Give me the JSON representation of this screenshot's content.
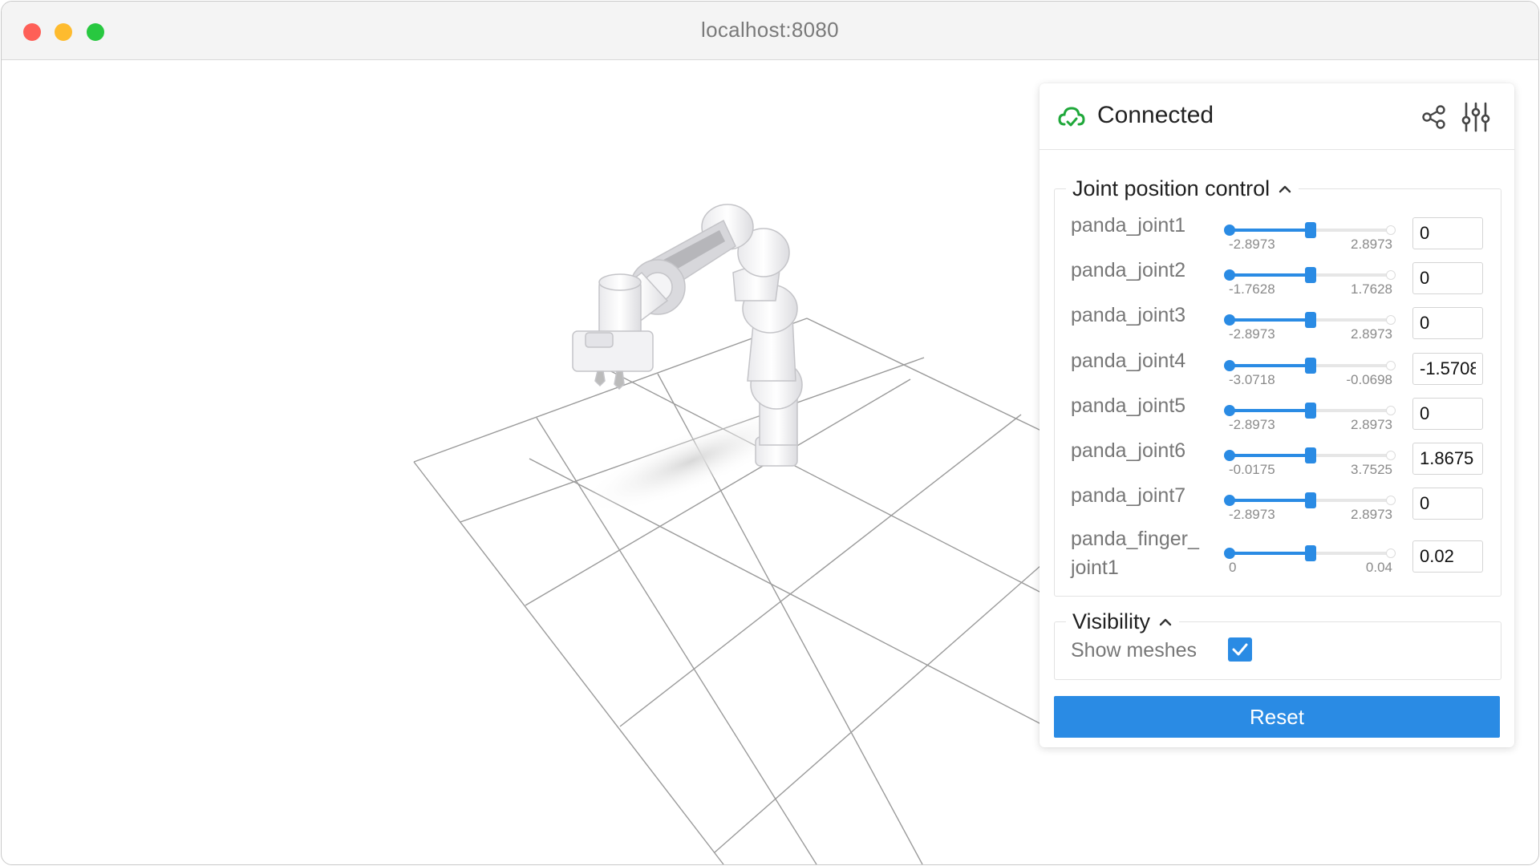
{
  "window": {
    "url": "localhost:8080"
  },
  "panel": {
    "status": "Connected",
    "status_color": "#1fa83a",
    "accent_color": "#2a8be4",
    "joint_group": {
      "title": "Joint position control",
      "joints": [
        {
          "label": "panda_joint1",
          "min": "-2.8973",
          "max": "2.8973",
          "value": "0",
          "fraction": 0.5
        },
        {
          "label": "panda_joint2",
          "min": "-1.7628",
          "max": "1.7628",
          "value": "0",
          "fraction": 0.5
        },
        {
          "label": "panda_joint3",
          "min": "-2.8973",
          "max": "2.8973",
          "value": "0",
          "fraction": 0.5
        },
        {
          "label": "panda_joint4",
          "min": "-3.0718",
          "max": "-0.0698",
          "value": "-1.5708",
          "fraction": 0.5
        },
        {
          "label": "panda_joint5",
          "min": "-2.8973",
          "max": "2.8973",
          "value": "0",
          "fraction": 0.5
        },
        {
          "label": "panda_joint6",
          "min": "-0.0175",
          "max": "3.7525",
          "value": "1.8675",
          "fraction": 0.5
        },
        {
          "label": "panda_joint7",
          "min": "-2.8973",
          "max": "2.8973",
          "value": "0",
          "fraction": 0.5
        },
        {
          "label": "panda_finger_joint1",
          "label_line1": "panda_finger_",
          "label_line2": "joint1",
          "min": "0",
          "max": "0.04",
          "value": "0.02",
          "fraction": 0.5
        }
      ]
    },
    "visibility_group": {
      "title": "Visibility",
      "show_meshes_label": "Show meshes",
      "show_meshes_checked": true
    },
    "reset_label": "Reset"
  },
  "icons": {
    "status": "cloud-check-icon",
    "share": "share-icon",
    "settings": "sliders-icon",
    "collapse": "chevron-up-icon"
  }
}
